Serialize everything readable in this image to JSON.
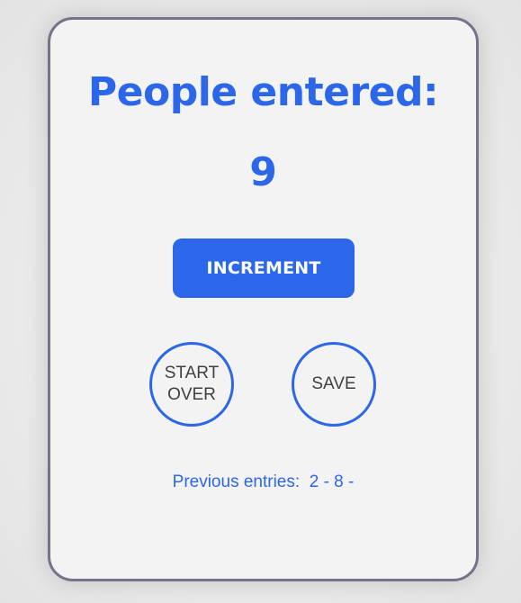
{
  "counter": {
    "title": "People entered:",
    "value": "9"
  },
  "buttons": {
    "increment_label": "INCREMENT",
    "start_over_line1": "START",
    "start_over_line2": "OVER",
    "save_label": "SAVE"
  },
  "history": {
    "label": "Previous entries:",
    "entries_text": "2 - 8 -"
  },
  "colors": {
    "accent": "#2b67e8",
    "card_background": "#f3f3f3",
    "card_border": "#74738a",
    "button_text": "#3f3f46"
  }
}
